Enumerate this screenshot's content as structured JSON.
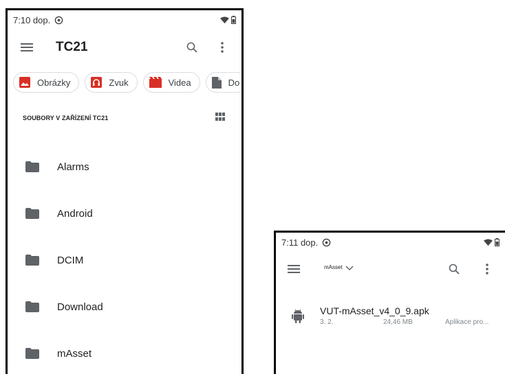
{
  "screen1": {
    "status": {
      "time": "7:10 dop."
    },
    "appbar": {
      "title": "TC21"
    },
    "chips": [
      {
        "label": "Obrázky",
        "icon": "image-icon",
        "color": "#d93025"
      },
      {
        "label": "Zvuk",
        "icon": "headphones-icon",
        "color": "#d93025"
      },
      {
        "label": "Videa",
        "icon": "movie-icon",
        "color": "#d93025"
      },
      {
        "label": "Do",
        "icon": "document-icon",
        "color": "#5f6368"
      }
    ],
    "section_label": "SOUBORY V ZAŘÍZENÍ TC21",
    "folders": [
      "Alarms",
      "Android",
      "DCIM",
      "Download",
      "mAsset"
    ]
  },
  "screen2": {
    "status": {
      "time": "7:11 dop."
    },
    "appbar": {
      "title": "mAsset"
    },
    "file": {
      "name": "VUT-mAsset_v4_0_9.apk",
      "date": "3. 2.",
      "size": "24,46 MB",
      "type": "Aplikace pro..."
    }
  }
}
